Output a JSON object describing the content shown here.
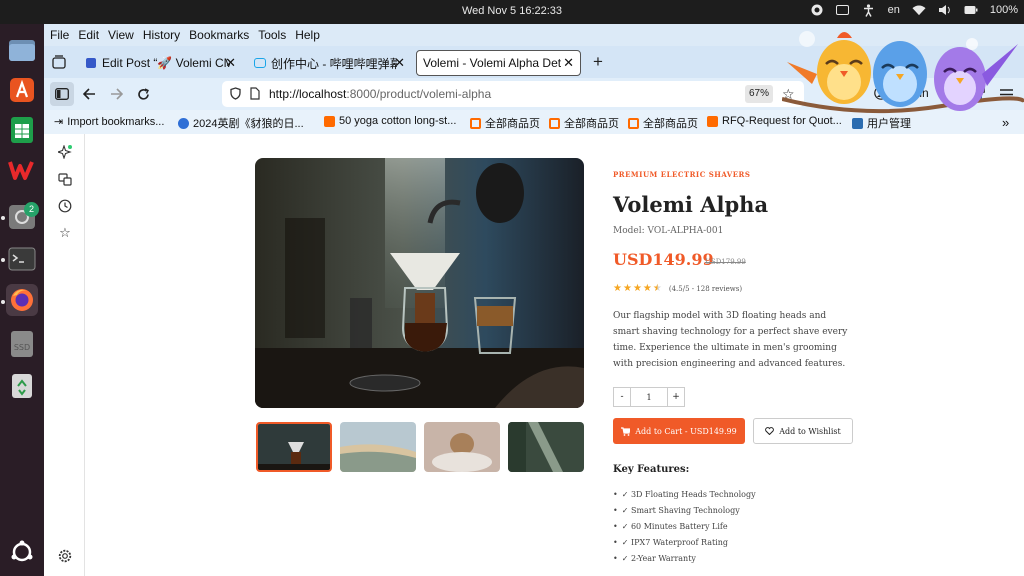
{
  "system": {
    "clock": "Wed Nov 5  16:22:33",
    "language": "en",
    "battery": "100%"
  },
  "dock": {
    "badge_count": "2",
    "items": [
      "files",
      "app-center",
      "spreadsheet",
      "wps-office",
      "software-updater",
      "terminal",
      "firefox",
      "ssd-drive",
      "trash",
      "show-apps"
    ]
  },
  "browser": {
    "menu": [
      "File",
      "Edit",
      "View",
      "History",
      "Bookmarks",
      "Tools",
      "Help"
    ],
    "tabs": [
      {
        "label": "Edit Post “🚀 Volemi CMS"
      },
      {
        "label": "创作中心 - 哔哩哔哩弹幕视"
      },
      {
        "label": "Volemi - Volemi Alpha Detail"
      }
    ],
    "url_host": "http://localhost",
    "url_path": ":8000/product/volemi-alpha",
    "zoom": "67%",
    "sign_in": "Sign in",
    "bookmarks": [
      "Import bookmarks...",
      "2024英剧《豺狼的日...",
      "50 yoga cotton long-st...",
      "全部商品页",
      "全部商品页",
      "全部商品页",
      "RFQ-Request for Quot...",
      "用户管理"
    ]
  },
  "product": {
    "category": "PREMIUM ELECTRIC SHAVERS",
    "title": "Volemi Alpha",
    "model": "Model: VOL-ALPHA-001",
    "price": "USD149.99",
    "old_price": "USD179.99",
    "rating_value": 4.5,
    "rating_text": "(4.5/5 - 128 reviews)",
    "description": "Our flagship model with 3D floating heads and smart shaving technology for a perfect shave every time. Experience the ultimate in men's grooming with precision engineering and advanced features.",
    "qty_minus": "-",
    "quantity": "1",
    "qty_plus": "+",
    "add_to_cart": "Add to Cart - USD149.99",
    "add_to_wishlist": "Add to Wishlist",
    "features_heading": "Key Features:",
    "features": [
      "✓ 3D Floating Heads Technology",
      "✓ Smart Shaving Technology",
      "✓ 60 Minutes Battery Life",
      "✓ IPX7 Waterproof Rating",
      "✓ 2-Year Warranty"
    ]
  },
  "colors": {
    "accent": "#f05a28",
    "star": "#f5a623",
    "dock_bg": "#2a1d26",
    "browser_chrome": "#dceaf7"
  }
}
